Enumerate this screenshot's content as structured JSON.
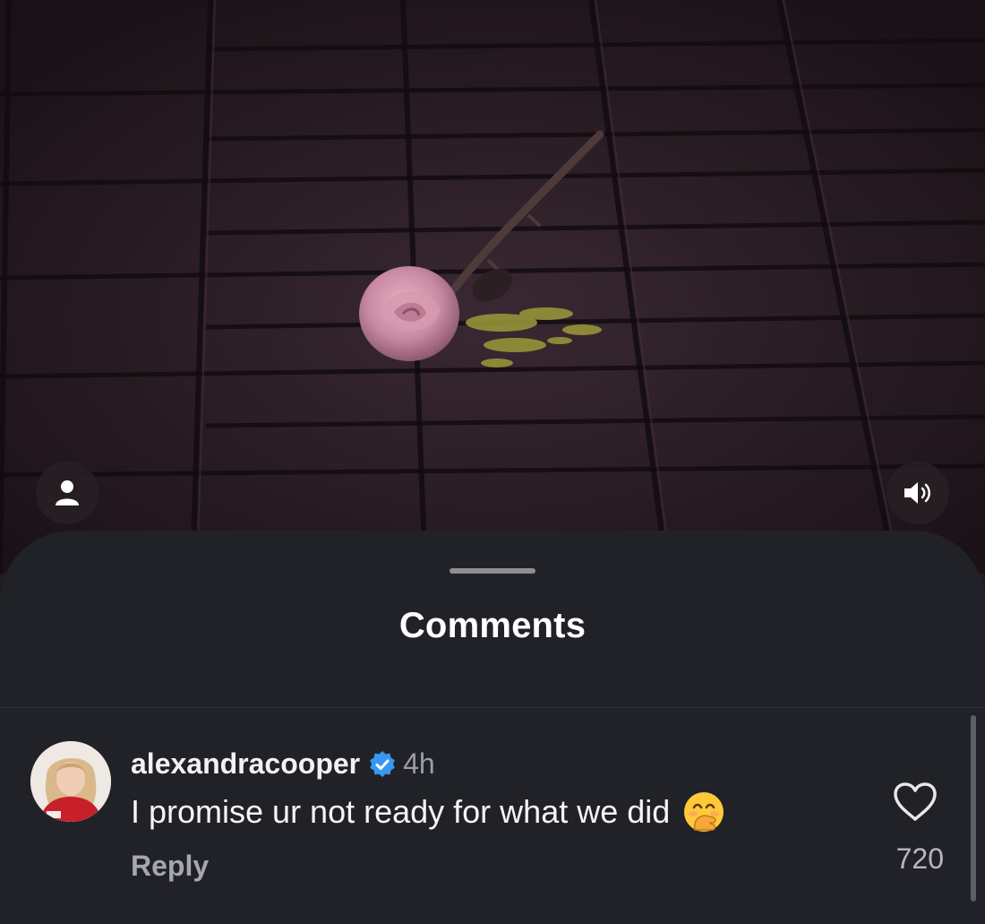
{
  "video": {
    "user_icon": "person-icon",
    "sound_icon": "speaker-icon"
  },
  "sheet": {
    "title": "Comments"
  },
  "comment": {
    "username": "alexandracooper",
    "verified": true,
    "timestamp": "4h",
    "text": "I promise ur not ready for what we did",
    "emoji_icon": "face-with-hand-over-mouth-emoji",
    "reply_label": "Reply",
    "like_icon": "heart-icon",
    "like_count": "720"
  },
  "colors": {
    "sheet_background": "#212228",
    "verified_badge": "#3897f0",
    "secondary_text": "#9c9ca3"
  }
}
